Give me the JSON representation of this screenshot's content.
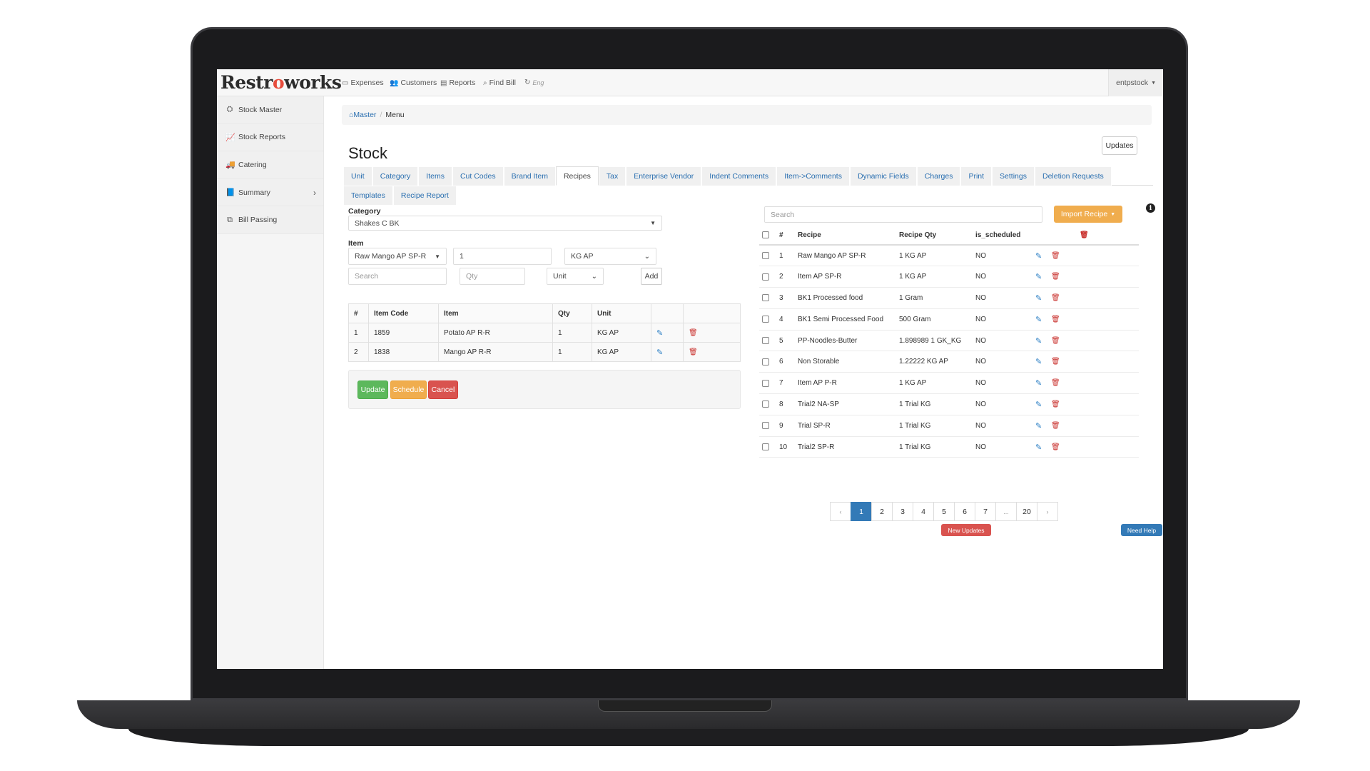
{
  "app": {
    "logo_left": "Restr",
    "logo_o": "o",
    "logo_right": "works"
  },
  "topnav": {
    "items": [
      {
        "icon": "expenses-icon",
        "label": "Expenses"
      },
      {
        "icon": "customers-icon",
        "label": "Customers"
      },
      {
        "icon": "reports-icon",
        "label": "Reports"
      },
      {
        "icon": "search-icon",
        "label": "Find Bill"
      },
      {
        "icon": "refresh-icon",
        "label": "Eng"
      }
    ],
    "user": "entpstock"
  },
  "sidebar": {
    "items": [
      {
        "icon": "cubes-icon",
        "label": "Stock Master"
      },
      {
        "icon": "line-chart-icon",
        "label": "Stock Reports"
      },
      {
        "icon": "truck-icon",
        "label": "Catering"
      },
      {
        "icon": "book-icon",
        "label": "Summary"
      },
      {
        "icon": "copy-icon",
        "label": "Bill Passing"
      }
    ]
  },
  "breadcrumb": {
    "home": "Master",
    "current": "Menu"
  },
  "page": {
    "title": "Stock",
    "updates_label": "Updates"
  },
  "tabs": {
    "row1": [
      "Unit",
      "Category",
      "Items",
      "Cut Codes",
      "Brand Item",
      "Recipes",
      "Tax",
      "Enterprise Vendor",
      "Indent Comments",
      "Item->Comments",
      "Dynamic Fields",
      "Charges",
      "Print",
      "Settings",
      "Deletion Requests"
    ],
    "row2": [
      "Templates",
      "Recipe Report"
    ],
    "active": "Recipes"
  },
  "form": {
    "category_label": "Category",
    "category_value": "Shakes C BK",
    "item_label": "Item",
    "item_value": "Raw Mango AP SP-R",
    "qty_value": "1",
    "unit_value": "KG AP",
    "search_placeholder": "Search",
    "qty_placeholder": "Qty",
    "unit_placeholder": "Unit",
    "add_label": "Add"
  },
  "items_table": {
    "headers": [
      "#",
      "Item Code",
      "Item",
      "Qty",
      "Unit"
    ],
    "rows": [
      {
        "num": "1",
        "code": "1859",
        "item": "Potato AP R-R",
        "qty": "1",
        "unit": "KG AP"
      },
      {
        "num": "2",
        "code": "1838",
        "item": "Mango AP R-R",
        "qty": "1",
        "unit": "KG AP"
      }
    ]
  },
  "actions": {
    "update": "Update",
    "schedule": "Schedule",
    "cancel": "Cancel"
  },
  "recipes": {
    "search_placeholder": "Search",
    "import_label": "Import Recipe",
    "headers": [
      "#",
      "Recipe",
      "Recipe Qty",
      "is_scheduled"
    ],
    "rows": [
      {
        "num": "1",
        "recipe": "Raw Mango AP SP-R",
        "qty": "1 KG AP",
        "scheduled": "NO"
      },
      {
        "num": "2",
        "recipe": "Item AP SP-R",
        "qty": "1 KG AP",
        "scheduled": "NO"
      },
      {
        "num": "3",
        "recipe": "BK1 Processed food",
        "qty": "1 Gram",
        "scheduled": "NO"
      },
      {
        "num": "4",
        "recipe": "BK1 Semi Processed Food",
        "qty": "500 Gram",
        "scheduled": "NO"
      },
      {
        "num": "5",
        "recipe": "PP-Noodles-Butter",
        "qty": "1.898989 1 GK_KG",
        "scheduled": "NO"
      },
      {
        "num": "6",
        "recipe": "Non Storable",
        "qty": "1.22222 KG AP",
        "scheduled": "NO"
      },
      {
        "num": "7",
        "recipe": "Item AP P-R",
        "qty": "1 KG AP",
        "scheduled": "NO"
      },
      {
        "num": "8",
        "recipe": "Trial2 NA-SP",
        "qty": "1 Trial KG",
        "scheduled": "NO"
      },
      {
        "num": "9",
        "recipe": "Trial SP-R",
        "qty": "1 Trial KG",
        "scheduled": "NO"
      },
      {
        "num": "10",
        "recipe": "Trial2 SP-R",
        "qty": "1 Trial KG",
        "scheduled": "NO"
      }
    ]
  },
  "pagination": {
    "prev": "‹",
    "pages": [
      "1",
      "2",
      "3",
      "4",
      "5",
      "6",
      "7",
      "...",
      "20"
    ],
    "next": "›",
    "active": "1"
  },
  "footer": {
    "new_updates": "New Updates",
    "need_help": "Need Help"
  }
}
